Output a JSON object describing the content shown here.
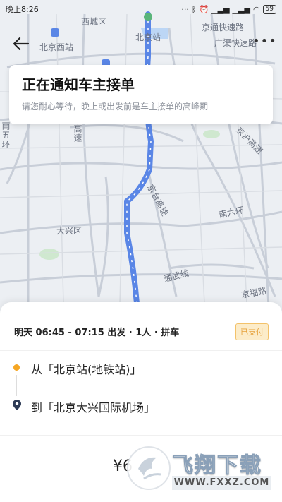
{
  "status_bar": {
    "time": "晚上8:26",
    "battery": "59",
    "icons": [
      "bluetooth-icon",
      "alarm-icon",
      "signal-icon",
      "signal-icon",
      "wifi-icon",
      "battery-icon"
    ]
  },
  "map": {
    "labels": {
      "xicheng": "西城区",
      "beijing_west": "北京西站",
      "beijing_station": "北京站",
      "jingtong": "京通快速路",
      "guangqu": "广渠快速路",
      "jinghu": "京沪高速",
      "jingtai": "京台高速",
      "daxing": "大兴区",
      "nanliuhuan": "南六环",
      "tongwu": "通武线",
      "jingfu": "京福路",
      "nanwuhuan": "南五环",
      "gaosu": "高速"
    },
    "colors": {
      "route": "#5a86e6",
      "road": "#c8ced8",
      "water": "#bcd6f5",
      "green": "#cfe8cf"
    }
  },
  "notice": {
    "title": "正在通知车主接单",
    "subtitle": "请您耐心等待，晚上或出发前是车主接单的高峰期"
  },
  "trip": {
    "info": "明天 06:45 - 07:15 出发 · 1人 · 拼车",
    "paid": "已支付",
    "from": "从「北京站(地铁站)」",
    "to": "到「北京大兴国际机场」",
    "price": "¥6"
  },
  "watermark": {
    "brand": "飞翔下载",
    "url": "WWW.FXXZ.COM"
  },
  "colors": {
    "accent": "#f5a623",
    "paid_bg": "#fcecc9",
    "paid_text": "#e6a23c"
  }
}
